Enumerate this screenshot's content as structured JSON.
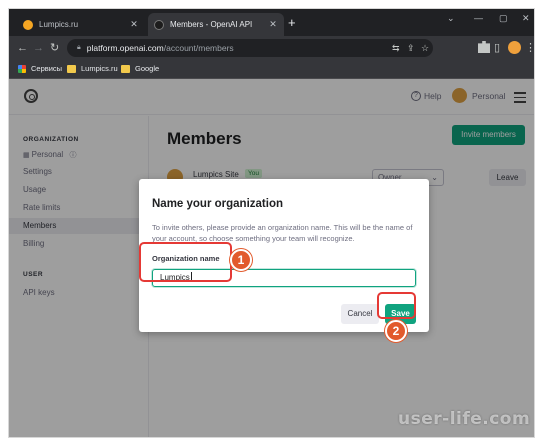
{
  "browser": {
    "tabs": [
      {
        "title": "Lumpics.ru",
        "active": false
      },
      {
        "title": "Members - OpenAI API",
        "active": true
      }
    ],
    "new_tab_label": "+",
    "close_label": "✕",
    "url_domain": "platform.openai.com",
    "url_path": "/account/members",
    "bookmarks": [
      "Сервисы",
      "Lumpics.ru",
      "Google"
    ],
    "window_controls": [
      "⌄",
      "—",
      "▢",
      "✕"
    ]
  },
  "topnav": {
    "help_label": "Help",
    "account_label": "Personal"
  },
  "sidebar": {
    "organization_heading": "ORGANIZATION",
    "org_items": [
      {
        "label": "Personal",
        "active": false
      },
      {
        "label": "Settings",
        "active": false
      },
      {
        "label": "Usage",
        "active": false
      },
      {
        "label": "Rate limits",
        "active": false
      },
      {
        "label": "Members",
        "active": true
      },
      {
        "label": "Billing",
        "active": false
      }
    ],
    "user_heading": "USER",
    "user_items": [
      {
        "label": "API keys",
        "active": false
      }
    ]
  },
  "main": {
    "title": "Members",
    "invite_button": "Invite members",
    "member": {
      "name": "Lumpics Site",
      "badge": "You",
      "role": "Owner",
      "leave_button": "Leave"
    }
  },
  "modal": {
    "title": "Name your organization",
    "description": "To invite others, please provide an organization name. This will be the name of your account, so choose something your team will recognize.",
    "field_label": "Organization name",
    "field_value": "Lumpics",
    "cancel_button": "Cancel",
    "save_button": "Save"
  },
  "annotations": {
    "step1": "1",
    "step2": "2",
    "highlight_color": "#e53935",
    "badge_color": "#e25a2c"
  },
  "watermark": "user-life.com",
  "colors": {
    "accent": "#10a37f",
    "chrome_dark": "#202124",
    "chrome_toolbar": "#35363a"
  }
}
